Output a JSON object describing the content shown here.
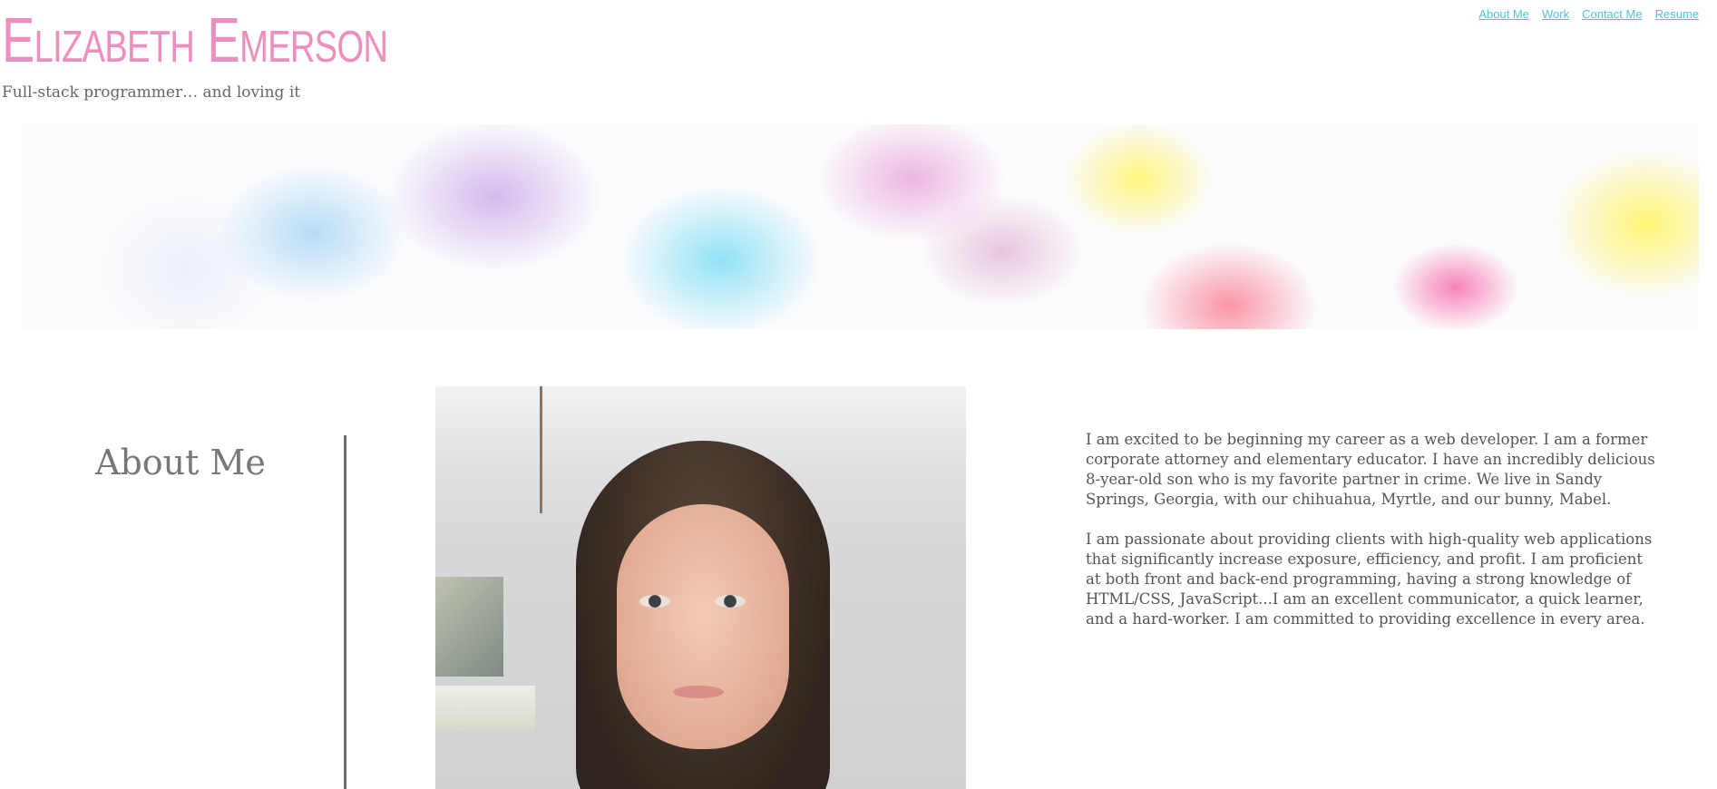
{
  "header": {
    "title": "Elizabeth Emerson",
    "tagline": "Full-stack programmer… and loving it"
  },
  "nav": {
    "items": [
      {
        "label": "About Me"
      },
      {
        "label": "Work"
      },
      {
        "label": "Contact Me"
      },
      {
        "label": "Resume"
      }
    ]
  },
  "banner": {
    "kind": "pastel-ink-clouds-image"
  },
  "about": {
    "heading": "About Me",
    "paragraphs": [
      "I am excited to be beginning my career as a web developer. I am a former corporate attorney and elementary educator. I have an incredibly delicious 8-year-old son who is my favorite partner in crime. We live in Sandy Springs, Georgia, with our chihuahua, Myrtle, and our bunny, Mabel.",
      "I am passionate about providing clients with high-quality web applications that significantly increase exposure, efficiency, and profit. I am proficient at both front and back-end programming, having a strong knowledge of HTML/CSS, JavaScript...I am an excellent communicator, a quick learner, and a hard-worker. I am committed to providing excellence in every area."
    ]
  },
  "colors": {
    "title": "#ec8fbf",
    "link": "#4cc6d4",
    "text": "#555555",
    "heading": "#777777"
  }
}
